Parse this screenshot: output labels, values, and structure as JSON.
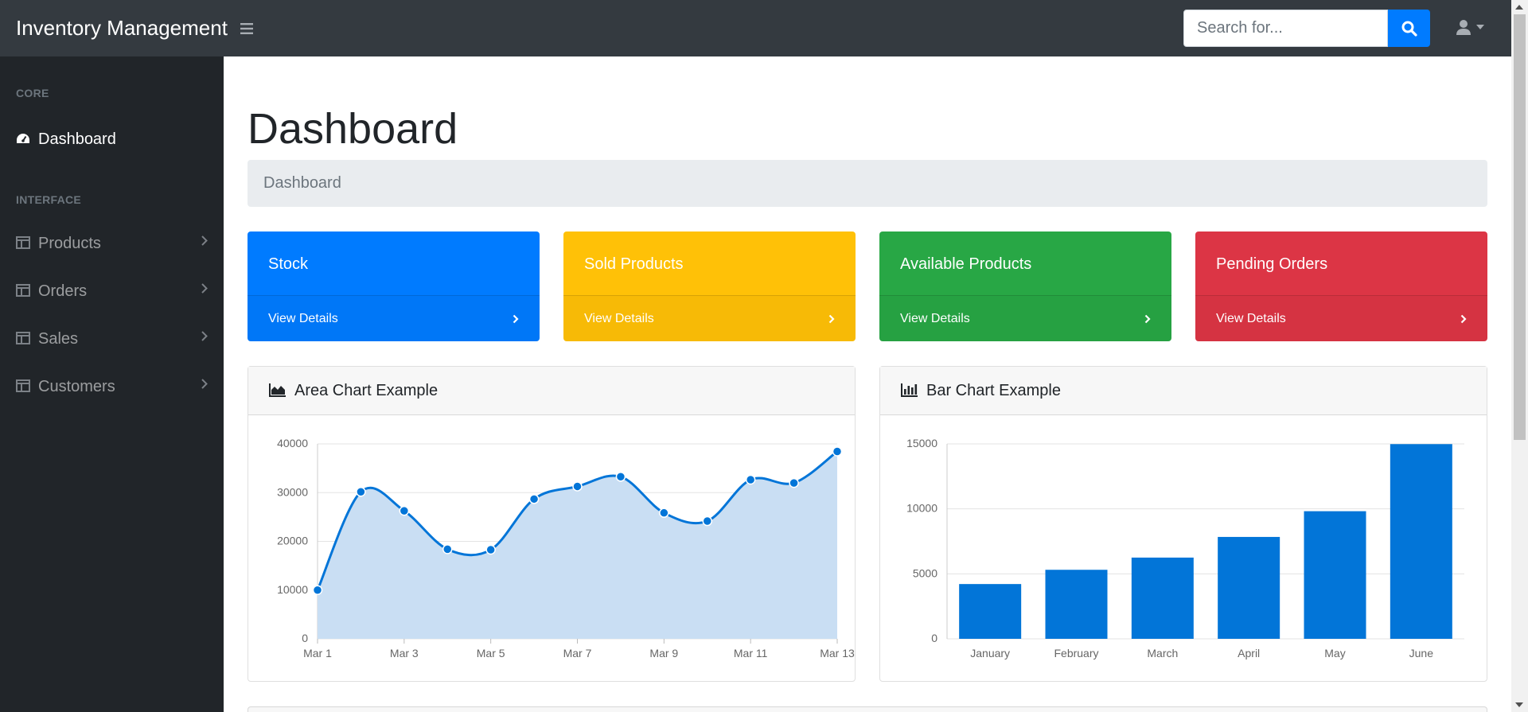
{
  "navbar": {
    "brand": "Inventory Management",
    "search_placeholder": "Search for..."
  },
  "sidebar": {
    "headings": {
      "core": "CORE",
      "interface": "INTERFACE"
    },
    "items": [
      {
        "label": "Dashboard",
        "icon": "tachometer-icon",
        "active": true
      },
      {
        "label": "Products",
        "icon": "table-icon"
      },
      {
        "label": "Orders",
        "icon": "table-icon"
      },
      {
        "label": "Sales",
        "icon": "table-icon"
      },
      {
        "label": "Customers",
        "icon": "table-icon"
      }
    ]
  },
  "main": {
    "title": "Dashboard",
    "breadcrumb": "Dashboard",
    "cards": [
      {
        "title": "Stock",
        "link": "View Details",
        "color": "#007bff"
      },
      {
        "title": "Sold Products",
        "link": "View Details",
        "color": "#ffc107"
      },
      {
        "title": "Available Products",
        "link": "View Details",
        "color": "#28a745"
      },
      {
        "title": "Pending Orders",
        "link": "View Details",
        "color": "#dc3545"
      }
    ],
    "area_chart_title": "Area Chart Example",
    "bar_chart_title": "Bar Chart Example"
  },
  "chart_data": [
    {
      "type": "area",
      "title": "Area Chart Example",
      "x": [
        "Mar 1",
        "Mar 2",
        "Mar 3",
        "Mar 4",
        "Mar 5",
        "Mar 6",
        "Mar 7",
        "Mar 8",
        "Mar 9",
        "Mar 10",
        "Mar 11",
        "Mar 12",
        "Mar 13"
      ],
      "x_tick_labels": [
        "Mar 1",
        "Mar 3",
        "Mar 5",
        "Mar 7",
        "Mar 9",
        "Mar 11",
        "Mar 13"
      ],
      "values": [
        10000,
        30162,
        26263,
        18394,
        18287,
        28682,
        31274,
        33259,
        25849,
        24159,
        32651,
        31984,
        38451
      ],
      "ylim": [
        0,
        40000
      ],
      "y_ticks": [
        0,
        10000,
        20000,
        30000,
        40000
      ],
      "grid": true,
      "color": "#0275d8",
      "fill": "#c9def3"
    },
    {
      "type": "bar",
      "title": "Bar Chart Example",
      "categories": [
        "January",
        "February",
        "March",
        "April",
        "May",
        "June"
      ],
      "values": [
        4215,
        5312,
        6251,
        7841,
        9821,
        14984
      ],
      "ylim": [
        0,
        15000
      ],
      "y_ticks": [
        0,
        5000,
        10000,
        15000
      ],
      "grid": true,
      "color": "#0275d8"
    }
  ]
}
